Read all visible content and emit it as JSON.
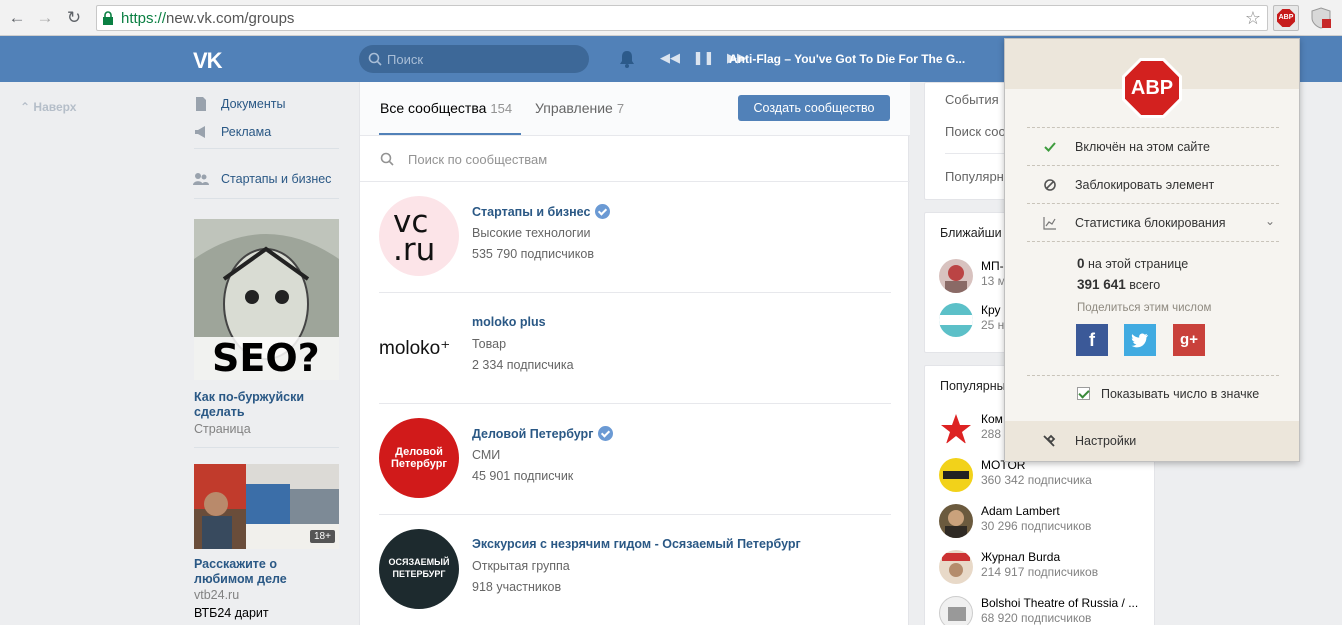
{
  "browser": {
    "url_scheme": "https://",
    "url_rest": "new.vk.com/groups",
    "back_icon": "←",
    "forward_icon": "→",
    "reload_icon": "↻",
    "star_icon": "☆",
    "ext_label": "ABP"
  },
  "header": {
    "logo": "VK",
    "search_placeholder": "Поиск",
    "player_controls": [
      "◀◀",
      "❚❚",
      "▶▶"
    ],
    "track": "Anti-Flag – You've Got To Die For The G..."
  },
  "left": {
    "up_label": "Наверх",
    "nav": [
      "Документы",
      "Реклама",
      "Стартапы и бизнес"
    ],
    "ad1": {
      "title": "Как по-буржуйски сделать",
      "sub": "Страница",
      "img_text": "SEO?"
    },
    "ad2": {
      "title": "Расскажите о любимом деле",
      "sub": "vtb24.ru",
      "desc": "ВТБ24 дарит",
      "badge": "18+"
    }
  },
  "main": {
    "tabs": [
      {
        "label": "Все сообщества",
        "count": "154"
      },
      {
        "label": "Управление",
        "count": "7"
      }
    ],
    "create_button": "Создать сообщество",
    "search_placeholder": "Поиск по сообществам",
    "groups": [
      {
        "name": "Стартапы и бизнес",
        "verified": true,
        "category": "Высокие технологии",
        "subs": "535 790 подписчиков",
        "avatar_text": "vc\n.ru"
      },
      {
        "name": "moloko plus",
        "verified": false,
        "category": "Товар",
        "subs": "2 334 подписчика",
        "avatar_text": "moloko⁺"
      },
      {
        "name": "Деловой Петербург",
        "verified": true,
        "category": "СМИ",
        "subs": "45 901 подписчик",
        "avatar_text": "Деловой Петербург"
      },
      {
        "name": "Экскурсия с незрячим гидом - Осязаемый Петербург",
        "verified": false,
        "category": "Открытая группа",
        "subs": "918 участников",
        "avatar_text": "ОСЯЗАЕМЫЙ ПЕТЕРБУРГ"
      }
    ]
  },
  "right": {
    "links": [
      "События",
      "Поиск соо",
      "Популярн"
    ],
    "nearby_title": "Ближайши",
    "nearby": [
      {
        "name": "МП-",
        "subs": "13 м"
      },
      {
        "name": "Кру",
        "subs": "25 н"
      }
    ],
    "popular_title": "Популярны",
    "popular": [
      {
        "name": "Ком",
        "subs": "288"
      },
      {
        "name": "MOTOR",
        "subs": "360 342 подписчика"
      },
      {
        "name": "Adam Lambert",
        "subs": "30 296 подписчиков"
      },
      {
        "name": "Журнал Burda",
        "subs": "214 917 подписчиков"
      },
      {
        "name": "Bolshoi Theatre of Russia / ...",
        "subs": "68 920 подписчиков"
      }
    ]
  },
  "abp": {
    "logo": "ABP",
    "enabled": "Включён на этом сайте",
    "block_element": "Заблокировать элемент",
    "stats": "Статистика блокирования",
    "page_count": "0",
    "page_label": "на этой странице",
    "total_count": "391 641",
    "total_label": "всего",
    "share": "Поделиться этим числом",
    "show_count": "Показывать число в значке",
    "settings": "Настройки"
  }
}
